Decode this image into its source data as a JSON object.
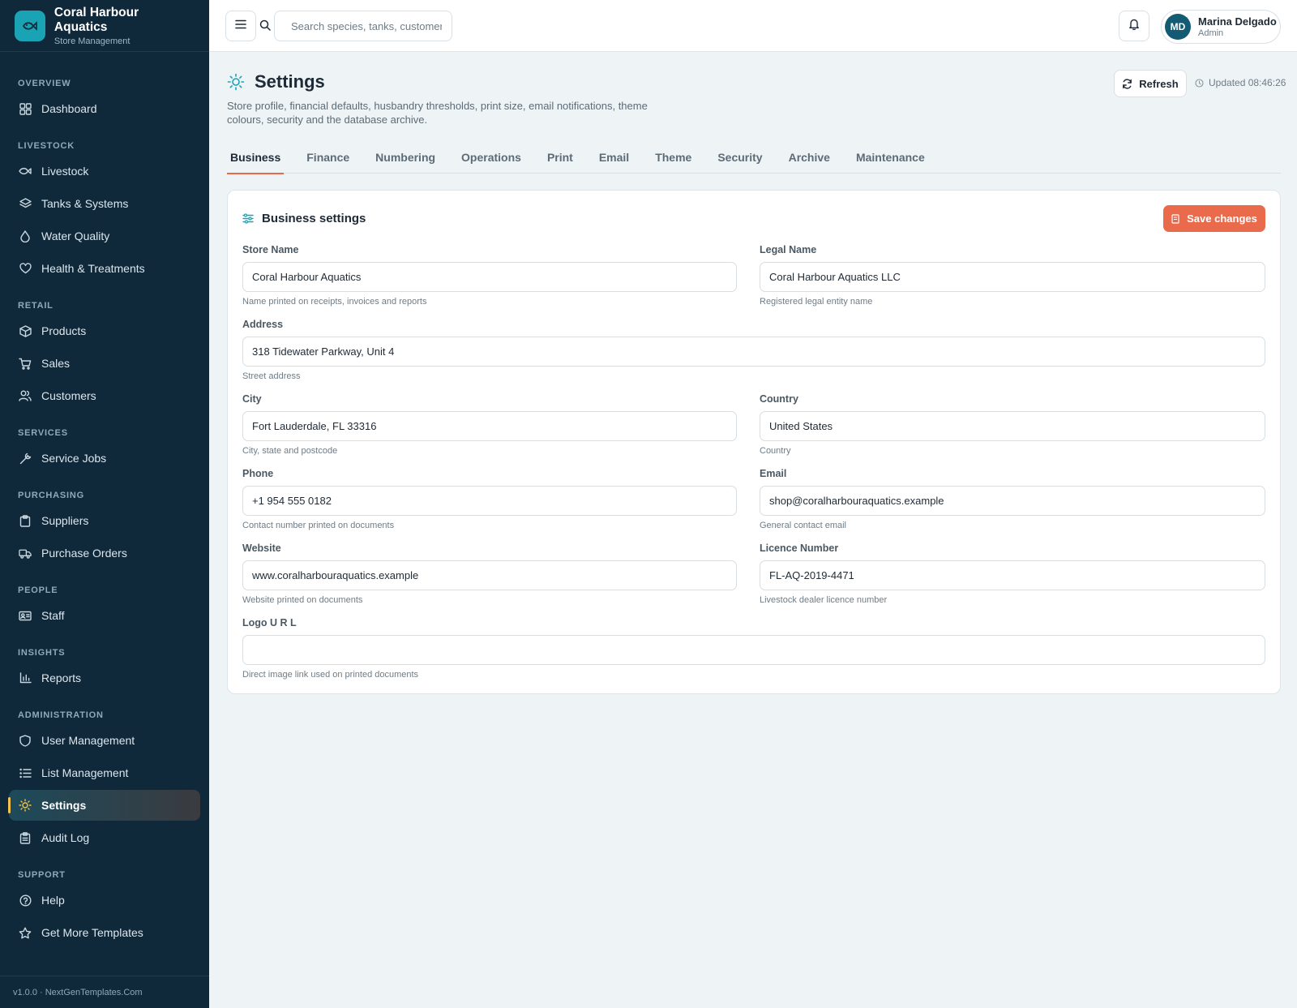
{
  "brand": {
    "title": "Coral Harbour Aquatics",
    "subtitle": "Store Management"
  },
  "nav": {
    "groups": [
      {
        "label": "OVERVIEW",
        "items": [
          {
            "label": "Dashboard",
            "icon": "dashboard-icon"
          }
        ]
      },
      {
        "label": "LIVESTOCK",
        "items": [
          {
            "label": "Livestock",
            "icon": "fish-icon"
          },
          {
            "label": "Tanks & Systems",
            "icon": "layers-icon"
          },
          {
            "label": "Water Quality",
            "icon": "droplet-icon"
          },
          {
            "label": "Health & Treatments",
            "icon": "heart-icon"
          }
        ]
      },
      {
        "label": "RETAIL",
        "items": [
          {
            "label": "Products",
            "icon": "box-icon"
          },
          {
            "label": "Sales",
            "icon": "cart-icon"
          },
          {
            "label": "Customers",
            "icon": "users-icon"
          }
        ]
      },
      {
        "label": "SERVICES",
        "items": [
          {
            "label": "Service Jobs",
            "icon": "wrench-icon"
          }
        ]
      },
      {
        "label": "PURCHASING",
        "items": [
          {
            "label": "Suppliers",
            "icon": "clipboard-icon"
          },
          {
            "label": "Purchase Orders",
            "icon": "truck-icon"
          }
        ]
      },
      {
        "label": "PEOPLE",
        "items": [
          {
            "label": "Staff",
            "icon": "id-card-icon"
          }
        ]
      },
      {
        "label": "INSIGHTS",
        "items": [
          {
            "label": "Reports",
            "icon": "bar-chart-icon"
          }
        ]
      },
      {
        "label": "ADMINISTRATION",
        "items": [
          {
            "label": "User Management",
            "icon": "shield-icon"
          },
          {
            "label": "List Management",
            "icon": "list-icon"
          },
          {
            "label": "Settings",
            "icon": "sun-icon",
            "active": true
          },
          {
            "label": "Audit Log",
            "icon": "audit-clipboard-icon"
          }
        ]
      },
      {
        "label": "SUPPORT",
        "items": [
          {
            "label": "Help",
            "icon": "help-circle-icon"
          },
          {
            "label": "Get More Templates",
            "icon": "star-icon"
          }
        ]
      }
    ],
    "footer": "v1.0.0 · NextGenTemplates.Com"
  },
  "topbar": {
    "search_placeholder": "Search species, tanks, customers…",
    "user": {
      "initials": "MD",
      "name": "Marina Delgado",
      "role": "Admin"
    }
  },
  "page": {
    "title": "Settings",
    "description": "Store profile, financial defaults, husbandry thresholds, print size, email notifications, theme colours, security and the database archive.",
    "refresh_label": "Refresh",
    "updated": "Updated 08:46:26",
    "tabs": [
      "Business",
      "Finance",
      "Numbering",
      "Operations",
      "Print",
      "Email",
      "Theme",
      "Security",
      "Archive",
      "Maintenance"
    ],
    "active_tab": "Business"
  },
  "card": {
    "title": "Business settings",
    "save_label": "Save changes",
    "fields": {
      "store_name": {
        "label": "Store Name",
        "value": "Coral Harbour Aquatics",
        "help": "Name printed on receipts, invoices and reports"
      },
      "legal_name": {
        "label": "Legal Name",
        "value": "Coral Harbour Aquatics LLC",
        "help": "Registered legal entity name"
      },
      "address": {
        "label": "Address",
        "value": "318 Tidewater Parkway, Unit 4",
        "help": "Street address"
      },
      "city": {
        "label": "City",
        "value": "Fort Lauderdale, FL 33316",
        "help": "City, state and postcode"
      },
      "country": {
        "label": "Country",
        "value": "United States",
        "help": "Country"
      },
      "phone": {
        "label": "Phone",
        "value": "+1 954 555 0182",
        "help": "Contact number printed on documents"
      },
      "email": {
        "label": "Email",
        "value": "shop@coralharbouraquatics.example",
        "help": "General contact email"
      },
      "website": {
        "label": "Website",
        "value": "www.coralharbouraquatics.example",
        "help": "Website printed on documents"
      },
      "licence": {
        "label": "Licence Number",
        "value": "FL-AQ-2019-4471",
        "help": "Livestock dealer licence number"
      },
      "logo_url": {
        "label": "Logo U R L",
        "value": "",
        "help": "Direct image link used on printed documents"
      }
    }
  },
  "colors": {
    "sidebar": "#10293a",
    "accent": "#ea6a4c",
    "brand": "#1aa3b4",
    "active_marker": "#f2c14e"
  }
}
